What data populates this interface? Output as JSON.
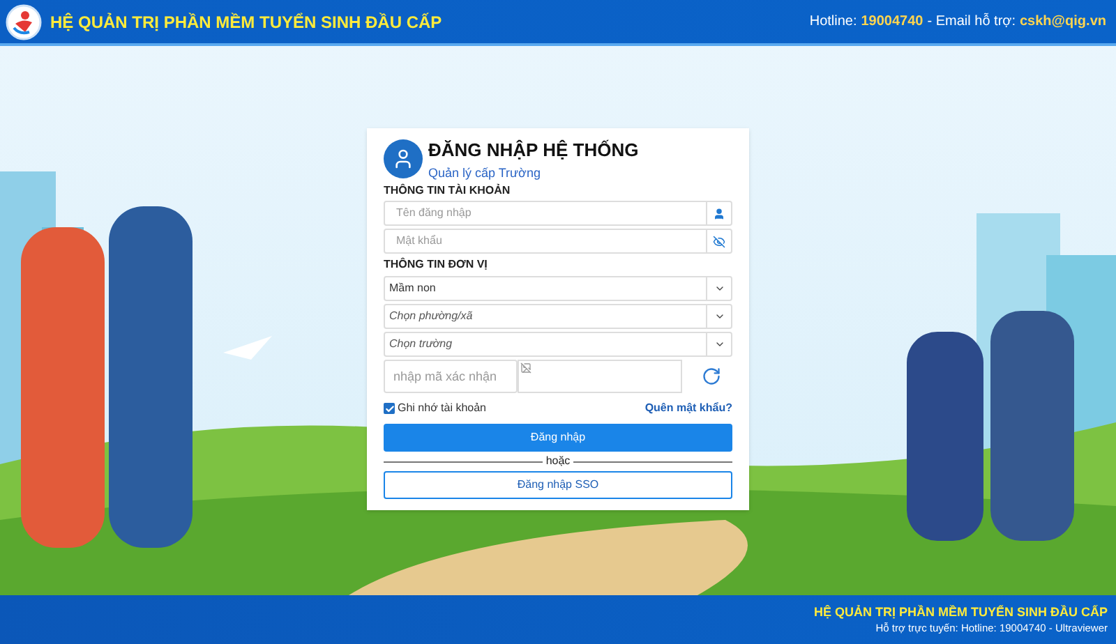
{
  "header": {
    "title": "HỆ QUẢN TRỊ PHẦN MỀM TUYỂN SINH ĐẦU CẤP",
    "hotline_label": "Hotline:",
    "hotline": "19004740",
    "email_label": "- Email hỗ trợ:",
    "email": "cskh@qig.vn"
  },
  "login": {
    "title": "ĐĂNG NHẬP HỆ THỐNG",
    "subtitle": "Quản lý cấp Trường",
    "account_section": "THÔNG TIN TÀI KHOẢN",
    "username": {
      "placeholder": "Tên đăng nhập"
    },
    "password": {
      "placeholder": "Mật khẩu"
    },
    "unit_section": "THÔNG TIN ĐƠN VỊ",
    "selects": [
      {
        "kind": "value",
        "text": "Mầm non"
      },
      {
        "kind": "placeholder",
        "text": "Chọn phường/xã"
      },
      {
        "kind": "placeholder",
        "text": "Chọn trường"
      }
    ],
    "captcha": {
      "placeholder": "nhập mã xác nhận"
    },
    "remember": {
      "label": "Ghi nhớ tài khoản",
      "checked": true
    },
    "forgot": "Quên mật khẩu?",
    "login_button": "Đăng nhập",
    "or": "hoặc",
    "sso_button": "Đăng nhập SSO"
  },
  "footer": {
    "title": "HỆ QUẢN TRỊ PHẦN MỀM TUYỂN SINH ĐẦU CẤP",
    "support": "Hỗ trợ trực tuyến: Hotline: 19004740 - Ultraviewer"
  }
}
